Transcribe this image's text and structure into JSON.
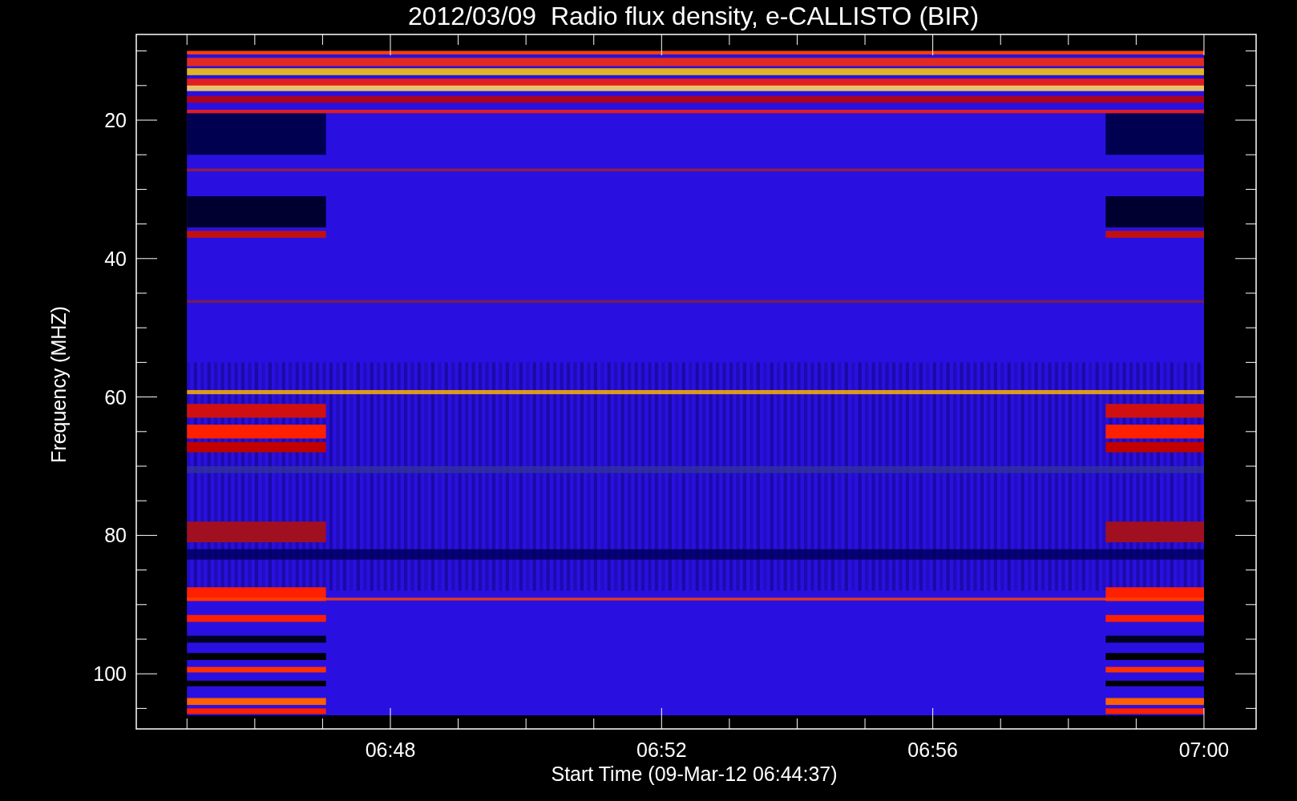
{
  "title": "2012/03/09  Radio flux density, e-CALLISTO (BIR)",
  "y_axis": {
    "label": "Frequency (MHZ)",
    "ticks": [
      "20",
      "40",
      "60",
      "80",
      "100"
    ]
  },
  "x_axis": {
    "label": "Start Time (09-Mar-12 06:44:37)",
    "ticks": [
      "06:48",
      "06:52",
      "06:56",
      "07:00"
    ]
  }
}
